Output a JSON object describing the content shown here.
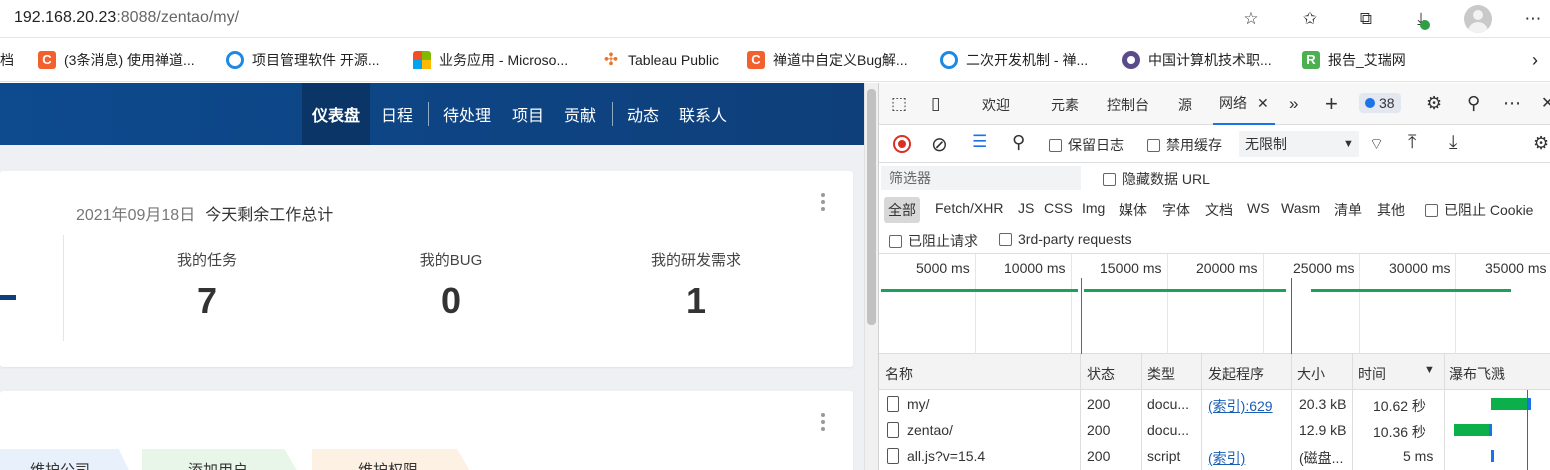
{
  "address_bar": {
    "url_host": "192.168.20.23",
    "url_rest": ":8088/zentao/my/"
  },
  "bookmarks": [
    {
      "label": "档",
      "icon": "none"
    },
    {
      "label": "(3条消息) 使用禅道...",
      "icon": "csdn-icon"
    },
    {
      "label": "项目管理软件 开源...",
      "icon": "zentao-icon"
    },
    {
      "label": "业务应用 - Microso...",
      "icon": "microsoft-icon"
    },
    {
      "label": "Tableau Public",
      "icon": "tableau-icon"
    },
    {
      "label": "禅道中自定义Bug解...",
      "icon": "csdn-icon"
    },
    {
      "label": "二次开发机制 - 禅...",
      "icon": "zentao-icon"
    },
    {
      "label": "中国计算机技术职...",
      "icon": "ceiaec-icon"
    },
    {
      "label": "报告_艾瑞网",
      "icon": "iresearch-icon"
    }
  ],
  "nav": {
    "items": [
      "仪表盘",
      "日程",
      "待处理",
      "项目",
      "贡献",
      "动态",
      "联系人"
    ],
    "active": "仪表盘"
  },
  "summary": {
    "date": "2021年09月18日",
    "title": "今天剩余工作总计",
    "stats": [
      {
        "label": "我的任务",
        "value": "7"
      },
      {
        "label": "我的BUG",
        "value": "0"
      },
      {
        "label": "我的研发需求",
        "value": "1"
      }
    ]
  },
  "quick_actions": [
    "维护公司",
    "添加用户",
    "维护权限"
  ],
  "devtools": {
    "tabs": [
      "欢迎",
      "元素",
      "控制台",
      "源",
      "网络"
    ],
    "selected_tab": "网络",
    "issue_count": "38",
    "toolbar": {
      "preserve_log": "保留日志",
      "disable_cache": "禁用缓存",
      "throttle": "无限制"
    },
    "filter_placeholder": "筛选器",
    "hide_data_urls": "隐藏数据 URL",
    "type_filters": [
      "全部",
      "Fetch/XHR",
      "JS",
      "CSS",
      "Img",
      "媒体",
      "字体",
      "文档",
      "WS",
      "Wasm",
      "清单",
      "其他"
    ],
    "blocked_cookies": "已阻止 Cookie",
    "blocked_requests": "已阻止请求",
    "third_party": "3rd-party requests",
    "timeline_ticks": [
      "5000 ms",
      "10000 ms",
      "15000 ms",
      "20000 ms",
      "25000 ms",
      "30000 ms",
      "35000 ms"
    ],
    "columns": [
      "名称",
      "状态",
      "类型",
      "发起程序",
      "大小",
      "时间",
      "瀑布飞溅"
    ],
    "requests": [
      {
        "name": "my/",
        "status": "200",
        "type": "docu...",
        "initiator": "(索引):629",
        "size": "20.3 kB",
        "time": "10.62 秒"
      },
      {
        "name": "zentao/",
        "status": "200",
        "type": "docu...",
        "initiator": "",
        "size": "12.9 kB",
        "time": "10.36 秒"
      },
      {
        "name": "all.js?v=15.4",
        "status": "200",
        "type": "script",
        "initiator": "(索引)",
        "size": "(磁盘...",
        "time": "5 ms"
      }
    ]
  },
  "colors": {
    "nav_bg": "#0e3f7a",
    "accent": "#1a73e8",
    "green": "#19a35a",
    "record": "#d93025"
  }
}
